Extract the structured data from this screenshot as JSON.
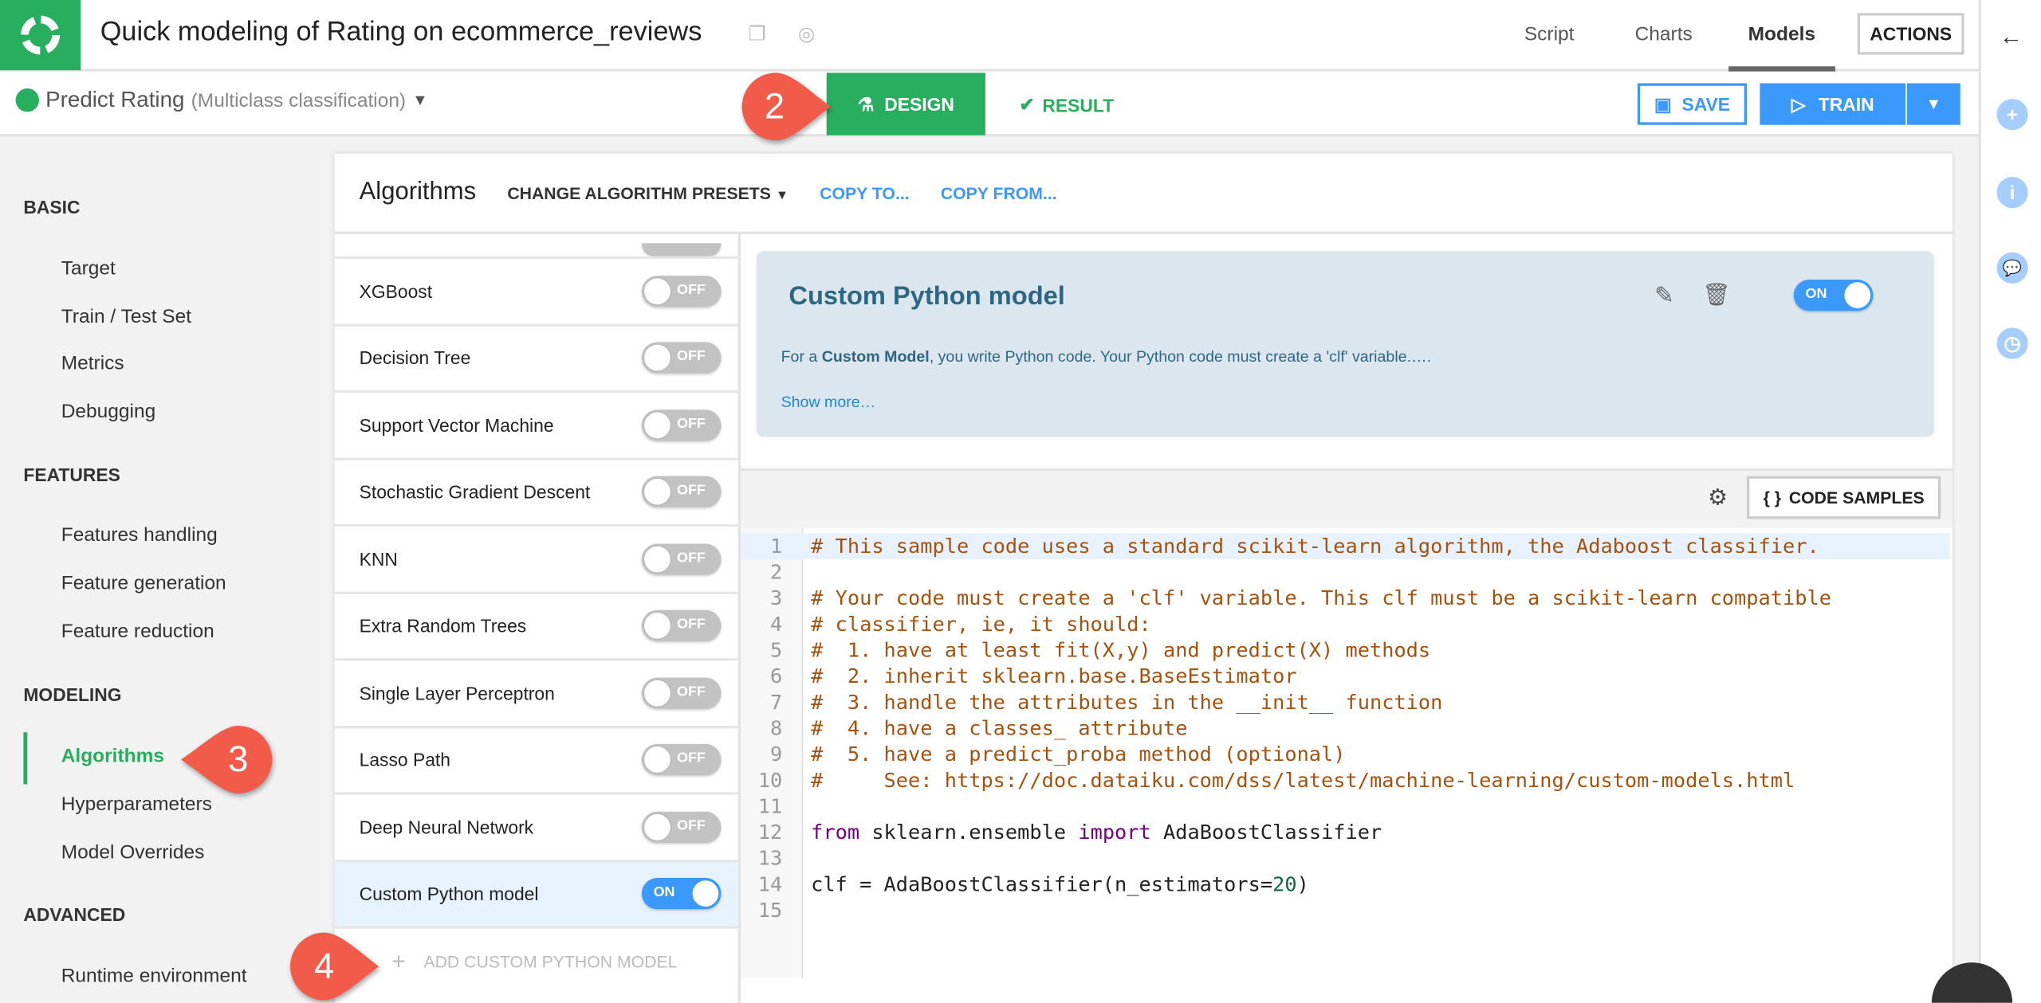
{
  "header": {
    "title": "Quick modeling of Rating on ecommerce_reviews",
    "nav": [
      "Script",
      "Charts",
      "Models"
    ],
    "active_nav": "Models",
    "actions_label": "ACTIONS"
  },
  "subheader": {
    "model_name": "Predict Rating",
    "model_type": "(Multiclass classification)",
    "design_label": "DESIGN",
    "result_label": "RESULT",
    "save_label": "SAVE",
    "train_label": "TRAIN"
  },
  "sidebar": {
    "sections": [
      {
        "title": "BASIC",
        "items": [
          "Target",
          "Train / Test Set",
          "Metrics",
          "Debugging"
        ]
      },
      {
        "title": "FEATURES",
        "items": [
          "Features handling",
          "Feature generation",
          "Feature reduction"
        ]
      },
      {
        "title": "MODELING",
        "items": [
          "Algorithms",
          "Hyperparameters",
          "Model Overrides"
        ]
      },
      {
        "title": "ADVANCED",
        "items": [
          "Runtime environment"
        ]
      }
    ],
    "active_item": "Algorithms"
  },
  "algorithms": {
    "title": "Algorithms",
    "presets_label": "CHANGE ALGORITHM PRESETS",
    "copy_to": "COPY TO...",
    "copy_from": "COPY FROM...",
    "list": [
      {
        "name": "XGBoost",
        "state": "OFF"
      },
      {
        "name": "Decision Tree",
        "state": "OFF"
      },
      {
        "name": "Support Vector Machine",
        "state": "OFF"
      },
      {
        "name": "Stochastic Gradient Descent",
        "state": "OFF"
      },
      {
        "name": "KNN",
        "state": "OFF"
      },
      {
        "name": "Extra Random Trees",
        "state": "OFF"
      },
      {
        "name": "Single Layer Perceptron",
        "state": "OFF"
      },
      {
        "name": "Lasso Path",
        "state": "OFF"
      },
      {
        "name": "Deep Neural Network",
        "state": "OFF"
      },
      {
        "name": "Custom Python model",
        "state": "ON"
      }
    ],
    "add_custom_label": "ADD CUSTOM PYTHON MODEL"
  },
  "custom_model": {
    "title": "Custom Python model",
    "toggle": "ON",
    "desc_prefix": "For a ",
    "desc_bold": "Custom Model",
    "desc_rest": ", you write Python code. Your Python code must create a 'clf' variable.….",
    "show_more": "Show more…",
    "code_samples_label": "CODE SAMPLES"
  },
  "code": [
    [
      [
        "comment",
        "# This sample code uses a standard scikit-learn algorithm, the Adaboost classifier."
      ]
    ],
    [],
    [
      [
        "comment",
        "# Your code must create a 'clf' variable. This clf must be a scikit-learn compatible"
      ]
    ],
    [
      [
        "comment",
        "# classifier, ie, it should:"
      ]
    ],
    [
      [
        "comment",
        "#  1. have at least fit(X,y) and predict(X) methods"
      ]
    ],
    [
      [
        "comment",
        "#  2. inherit sklearn.base.BaseEstimator"
      ]
    ],
    [
      [
        "comment",
        "#  3. handle the attributes in the __init__ function"
      ]
    ],
    [
      [
        "comment",
        "#  4. have a classes_ attribute"
      ]
    ],
    [
      [
        "comment",
        "#  5. have a predict_proba method (optional)"
      ]
    ],
    [
      [
        "comment",
        "#     See: https://doc.dataiku.com/dss/latest/machine-learning/custom-models.html"
      ]
    ],
    [],
    [
      [
        "kw",
        "from"
      ],
      [
        "plain",
        " sklearn.ensemble "
      ],
      [
        "kw",
        "import"
      ],
      [
        "plain",
        " AdaBoostClassifier"
      ]
    ],
    [],
    [
      [
        "plain",
        "clf = AdaBoostClassifier(n_estimators="
      ],
      [
        "num",
        "20"
      ],
      [
        "plain",
        ")"
      ]
    ],
    []
  ],
  "annotations": [
    "2",
    "3",
    "4"
  ],
  "colors": {
    "green": "#28ae5f",
    "blue": "#3b99fc",
    "badge": "#f25a4a"
  }
}
